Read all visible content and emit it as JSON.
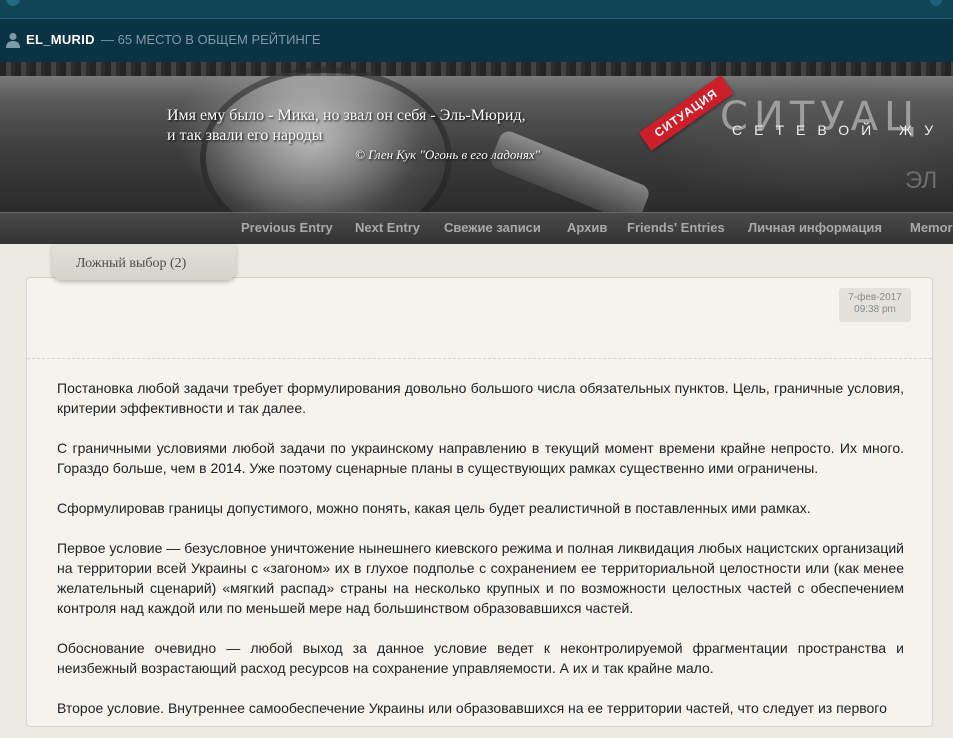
{
  "userbar": {
    "username": "EL_MURID",
    "rank": "— 65 МЕСТО В ОБЩЕМ РЕЙТИНГЕ"
  },
  "header": {
    "quote_line1": "Имя ему было - Мика, но звал он себя - Эль-Мюрид,",
    "quote_line2": "и так звали его народы",
    "quote_author": "©  Глен Кук \"Огонь в его ладонях\"",
    "ribbon": "СИТУАЦИЯ",
    "title": "СИТУАЦ",
    "subtitle": "СЕТЕВОЙ ЖУ",
    "subtitle2": "ЭЛ"
  },
  "nav": {
    "items": [
      "Previous Entry",
      "Next Entry",
      "Свежие записи",
      "Архив",
      "Friends' Entries",
      "Личная информация",
      "Memories"
    ]
  },
  "entry": {
    "title": "Ложный выбор (2)",
    "date": "7-фев-2017",
    "time": "09:38 pm",
    "paragraphs": [
      "Постановка любой задачи требует формулирования довольно большого числа обязательных пунктов. Цель, граничные условия, критерии эффективности и так далее.",
      "С граничными условиями любой задачи по украинскому направлению в текущий момент времени крайне непросто. Их много. Гораздо больше, чем в 2014. Уже поэтому сценарные планы в существующих рамках существенно ими ограничены.",
      "Сформулировав границы допустимого, можно понять, какая цель будет реалистичной в поставленных ими рамках.",
      "Первое условие — безусловное уничтожение нынешнего киевского режима и полная ликвидация любых нацистских организаций на территории всей Украины с «загоном» их в глухое подполье с сохранением ее территориальной целостности или (как менее желательный сценарий) «мягкий распад» страны на несколько крупных и по возможности целостных частей с обеспечением контроля над каждой или по меньшей мере над большинством образовавшихся частей.",
      "Обоснование очевидно — любой выход за данное условие ведет к неконтролируемой фрагментации пространства и неизбежный возрастающий расход ресурсов на сохранение управляемости. А их и так крайне мало.",
      "Второе условие. Внутреннее самообеспечение Украины или образовавшихся на ее территории частей, что следует из первого"
    ]
  }
}
